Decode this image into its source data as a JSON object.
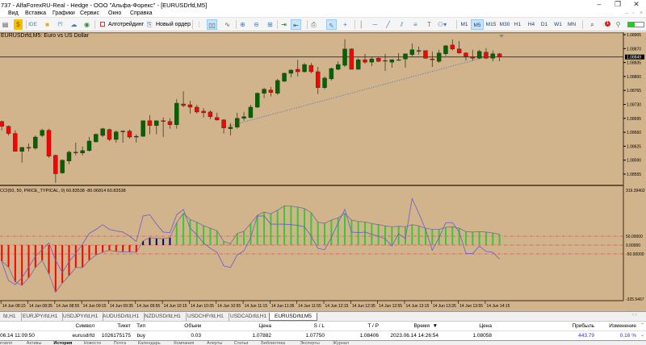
{
  "window": {
    "title": "737 - AlfaForexRU-Real - Hedge - ООО \"Альфа-Форекс\" - [EURUSDrfd,M5]",
    "minimize": "–",
    "maximize": "❐",
    "close": "✕"
  },
  "menu": [
    "Вид",
    "Вставка",
    "Графики",
    "Сервис",
    "Окно",
    "Справка"
  ],
  "toolbar": {
    "algo_label": "Алготрейдинг",
    "new_order_label": "Новый ордер",
    "ide_label": "IDE",
    "timeframes": [
      "M1",
      "M5",
      "M15",
      "M30",
      "H1",
      "H4",
      "D1",
      "W1",
      "MN"
    ],
    "active_timeframe": "M5",
    "notification_count": "1"
  },
  "chart": {
    "title": "EURUSDrfd,M5: Euro vs US Dollar",
    "indicator_label": "CCI(50, 50, PRICE_TYPICAL, 0) 60.83538 -80.06814 60.83538",
    "price_labels": [
      "1.08905",
      "1.08870",
      "1.08835",
      "1.08800",
      "1.08765",
      "1.08730",
      "1.08695",
      "1.08660",
      "1.08625",
      "1.08590",
      "1.08555"
    ],
    "current_price": "1.08849",
    "indicator_levels": [
      "319.39402",
      "50.00000",
      "0.00000",
      "-50.00000",
      "-325.5467"
    ],
    "time_labels": [
      "14 Jun 08:15",
      "14 Jun 08:35",
      "14 Jun 08:55",
      "14 Jun 09:15",
      "14 Jun 09:35",
      "14 Jun 09:55",
      "14 Jun 10:15",
      "14 Jun 10:35",
      "14 Jun 10:55",
      "14 Jun 11:15",
      "14 Jun 11:35",
      "14 Jun 11:55",
      "14 Jun 12:15",
      "14 Jun 12:35",
      "14 Jun 12:55",
      "14 Jun 13:15",
      "14 Jun 13:35",
      "14 Jun 13:55",
      "14 Jun 14:15"
    ],
    "colors": {
      "bg": "#d1b48c",
      "bull": "#006400",
      "bear": "#ff0000",
      "cci_line": "#6a5acd",
      "level": "#e05050",
      "hist_pos": "#33cc33",
      "hist_mid": "#000080",
      "hist_neg": "#ff0000"
    }
  },
  "chart_data": {
    "type": "candlestick",
    "symbol": "EURUSDrfd",
    "timeframe": "M5",
    "ylim": [
      1.0855,
      1.0891
    ],
    "ohlc": [
      [
        1.08687,
        1.08689,
        1.08665,
        1.08675
      ],
      [
        1.08675,
        1.08677,
        1.08652,
        1.08657
      ],
      [
        1.08657,
        1.08665,
        1.08612,
        1.08612
      ],
      [
        1.08612,
        1.08622,
        1.08584,
        1.08622
      ],
      [
        1.08622,
        1.08632,
        1.08612,
        1.0862
      ],
      [
        1.0862,
        1.08652,
        1.08616,
        1.08648
      ],
      [
        1.08652,
        1.08669,
        1.08648,
        1.08665
      ],
      [
        1.08665,
        1.08669,
        1.08596,
        1.086
      ],
      [
        1.08602,
        1.08604,
        1.08533,
        1.08556
      ],
      [
        1.08558,
        1.08592,
        1.08556,
        1.0859
      ],
      [
        1.08588,
        1.08614,
        1.0858,
        1.0861
      ],
      [
        1.0861,
        1.08634,
        1.08602,
        1.0861
      ],
      [
        1.08608,
        1.08624,
        1.08602,
        1.08614
      ],
      [
        1.08614,
        1.08648,
        1.08612,
        1.08638
      ],
      [
        1.08636,
        1.08657,
        1.08634,
        1.08655
      ],
      [
        1.08652,
        1.08671,
        1.08648,
        1.08669
      ],
      [
        1.08667,
        1.08669,
        1.08638,
        1.08642
      ],
      [
        1.08642,
        1.08665,
        1.08634,
        1.08661
      ],
      [
        1.08661,
        1.08665,
        1.08634,
        1.08663
      ],
      [
        1.08663,
        1.08667,
        1.08644,
        1.08648
      ],
      [
        1.08648,
        1.08655,
        1.08634,
        1.0865
      ],
      [
        1.0865,
        1.08689,
        1.08648,
        1.08689
      ],
      [
        1.08689,
        1.08703,
        1.08655,
        1.08677
      ],
      [
        1.08677,
        1.08689,
        1.08655,
        1.08689
      ],
      [
        1.08689,
        1.08697,
        1.08648,
        1.08687
      ],
      [
        1.08687,
        1.08695,
        1.08669,
        1.08679
      ],
      [
        1.08679,
        1.08743,
        1.08669,
        1.08733
      ],
      [
        1.08731,
        1.08763,
        1.08723,
        1.08727
      ],
      [
        1.08729,
        1.08739,
        1.08707,
        1.08723
      ],
      [
        1.08723,
        1.08729,
        1.08707,
        1.08711
      ],
      [
        1.08713,
        1.08721,
        1.08697,
        1.08709
      ],
      [
        1.08711,
        1.08715,
        1.08693,
        1.08699
      ],
      [
        1.08697,
        1.08709,
        1.08689,
        1.08691
      ],
      [
        1.08691,
        1.08693,
        1.08657,
        1.08671
      ],
      [
        1.08669,
        1.08683,
        1.08652,
        1.08673
      ],
      [
        1.08673,
        1.08709,
        1.08669,
        1.08695
      ],
      [
        1.08695,
        1.08711,
        1.08689,
        1.08699
      ],
      [
        1.08697,
        1.08729,
        1.08695,
        1.08723
      ],
      [
        1.08723,
        1.0876,
        1.08721,
        1.08758
      ],
      [
        1.08758,
        1.08772,
        1.08746,
        1.08768
      ],
      [
        1.08766,
        1.08774,
        1.0875,
        1.0876
      ],
      [
        1.08758,
        1.08794,
        1.08754,
        1.0879
      ],
      [
        1.08788,
        1.0881,
        1.08786,
        1.08808
      ],
      [
        1.08808,
        1.08818,
        1.08798,
        1.08816
      ],
      [
        1.08818,
        1.08842,
        1.088,
        1.08812
      ],
      [
        1.08812,
        1.08834,
        1.0881,
        1.0883
      ],
      [
        1.08828,
        1.08834,
        1.08808,
        1.08812
      ],
      [
        1.08812,
        1.08824,
        1.08756,
        1.08772
      ],
      [
        1.08772,
        1.088,
        1.08768,
        1.08796
      ],
      [
        1.08794,
        1.08822,
        1.0879,
        1.0882
      ],
      [
        1.08818,
        1.08838,
        1.08816,
        1.0883
      ],
      [
        1.08828,
        1.08893,
        1.08824,
        1.08869
      ],
      [
        1.08869,
        1.08871,
        1.08818,
        1.08818
      ],
      [
        1.08818,
        1.08846,
        1.08818,
        1.08842
      ],
      [
        1.08842,
        1.08857,
        1.08832,
        1.08836
      ],
      [
        1.08836,
        1.0885,
        1.08826,
        1.08844
      ],
      [
        1.08846,
        1.08848,
        1.08836,
        1.08838
      ],
      [
        1.0884,
        1.08857,
        1.08814,
        1.0884
      ],
      [
        1.08836,
        1.08844,
        1.08822,
        1.08842
      ],
      [
        1.08842,
        1.08859,
        1.0884,
        1.08842
      ],
      [
        1.08844,
        1.08857,
        1.08822,
        1.08857
      ],
      [
        1.08855,
        1.08883,
        1.0885,
        1.08867
      ],
      [
        1.08865,
        1.08875,
        1.08855,
        1.08863
      ],
      [
        1.08865,
        1.08865,
        1.08844,
        1.08846
      ],
      [
        1.08844,
        1.08863,
        1.08824,
        1.08842
      ],
      [
        1.08838,
        1.08867,
        1.08834,
        1.08859
      ],
      [
        1.08857,
        1.08879,
        1.08852,
        1.08877
      ],
      [
        1.08879,
        1.08893,
        1.08865,
        1.08869
      ],
      [
        1.08869,
        1.08889,
        1.08857,
        1.08859
      ],
      [
        1.08859,
        1.08861,
        1.0884,
        1.0885
      ],
      [
        1.0885,
        1.08867,
        1.0884,
        1.08846
      ],
      [
        1.08846,
        1.08867,
        1.08844,
        1.08863
      ],
      [
        1.08861,
        1.08871,
        1.08844,
        1.08846
      ],
      [
        1.08846,
        1.08865,
        1.08838,
        1.08857
      ],
      [
        1.08857,
        1.08859,
        1.08838,
        1.08849
      ]
    ],
    "trendline": {
      "from": {
        "bar": 34,
        "price": 1.08677
      },
      "to": {
        "bar": 72,
        "price": 1.08849
      }
    },
    "indicator": {
      "name": "CCI",
      "ylim": [
        -325.5467,
        319.39402
      ],
      "levels": [
        50,
        0,
        -50
      ],
      "histogram": [
        -91,
        -124,
        -208,
        -227,
        -185,
        -127,
        -86,
        -162,
        -265,
        -215,
        -173,
        -127,
        -127,
        -86,
        -56,
        -41,
        -30,
        -36,
        -39,
        -39,
        -41,
        23,
        42,
        38,
        36,
        42,
        126,
        179,
        144,
        129,
        109,
        95,
        80,
        20,
        8,
        65,
        77,
        121,
        168,
        186,
        176,
        197,
        221,
        220,
        214,
        206,
        182,
        129,
        123,
        141,
        153,
        179,
        141,
        133,
        130,
        121,
        115,
        108,
        103,
        106,
        103,
        115,
        108,
        95,
        88,
        88,
        100,
        103,
        95,
        76,
        73,
        76,
        73,
        68,
        61
      ],
      "histogram_colors": "rrrrrrrrrrrrrrrrrrrrrbbbbbggggggggggggggggggggggggggggggggggggggggggggggggg",
      "line": [
        -94,
        -200,
        -223,
        -185,
        -124,
        -64,
        -26,
        12,
        -86,
        -155,
        -94,
        -48,
        5,
        65,
        88,
        115,
        88,
        80,
        73,
        50,
        20,
        164,
        171,
        118,
        73,
        70,
        171,
        201,
        95,
        58,
        12,
        -18,
        -41,
        -117,
        -127,
        -56,
        -33,
        42,
        164,
        164,
        118,
        118,
        118,
        115,
        111,
        103,
        50,
        -18,
        -26,
        42,
        126,
        201,
        73,
        70,
        73,
        61,
        50,
        35,
        -6,
        65,
        35,
        262,
        179,
        88,
        -30,
        42,
        126,
        126,
        73,
        -48,
        -48,
        -6,
        -36,
        -41,
        -79
      ]
    }
  },
  "symbol_tabs": [
    "fd,H1",
    "EURJPYrfd,H1",
    "USDJPYrfd,H1",
    "AUDUSDrfd,H1",
    "NZDUSDrfd,H1",
    "USDCHFrfd,H1",
    "USDCADrfd,H1",
    "EURUSDrfd,M5"
  ],
  "table": {
    "headers": [
      "Символ",
      "Тикет",
      "Тип",
      "Объем",
      "Цена",
      "S / L",
      "T / P",
      "Время",
      "Цена",
      "Прибыль",
      "Изменение"
    ],
    "sort_arrow": "▼",
    "row": {
      "open_time": "06.14 11:09:50",
      "symbol": "eurusdrfd",
      "ticket": "1026175175",
      "type": "buy",
      "volume": "0.03",
      "price": "1.07882",
      "sl": "1.07750",
      "tp": "1.08406",
      "time": "2023.06.14 14:26:54",
      "current_price": "1.08058",
      "profit": "443.79",
      "change": "0.16 %"
    }
  },
  "bottom_tabs": [
    "Торговля",
    "Активы",
    "История",
    "Новости",
    "Почта",
    "Календарь",
    "Компания",
    "Алерты",
    "Статьи",
    "Библиотека",
    "Эксперты",
    "Журнал"
  ]
}
